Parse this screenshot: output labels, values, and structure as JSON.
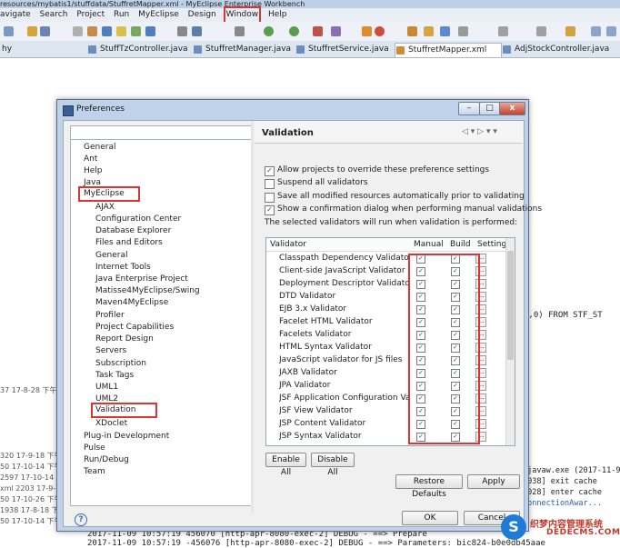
{
  "window": {
    "title": "resources/mybatis1/stuffdata/StuffretMapper.xml - MyEclipse Enterprise Workbench",
    "menu": [
      "avigate",
      "Search",
      "Project",
      "Run",
      "MyEclipse",
      "Design",
      "Window",
      "Help"
    ],
    "left_tab_fragment": "hy"
  },
  "file_tabs": [
    "StuffTzController.java",
    "StuffretManager.java",
    "StuffretService.java",
    "StuffretMapper.xml",
    "AdjStockController.java"
  ],
  "background": {
    "left_fragments": [
      "37  17-8-28 下午",
      "320  17-9-18 下午",
      "50  17-10-14 下午",
      "2597  17-10-14 下午",
      "xml  2203  17-9-18 下午",
      "50  17-10-26 下午",
      "1938  17-8-18 下午",
      "50  17-10-14 下午"
    ],
    "sql_fragment": "),0) FROM STF_ST",
    "right_fragments": [
      "\\javaw.exe (2017-11-9 ",
      "1038] exit cache",
      "1028] enter cache",
      "ConnectionAwar..."
    ],
    "log_lines": [
      "2017-11-09 10:57:19  456070 [http-apr-8080-exec-2] DEBUG  - ==> Prepare",
      "2017-11-09 10:57:19 -456076 [http-apr-8080-exec-2] DEBUG  - ==> Parameters: bic824-b0e0db45aae"
    ]
  },
  "watermark": {
    "text": "织梦内容管理系统",
    "url": "DEDECMS.COM"
  },
  "dialog": {
    "title": "Preferences",
    "filter_placeholder": "",
    "tree": [
      "General",
      "Ant",
      "Help",
      "Java",
      "MyEclipse",
      "AJAX",
      "Configuration Center",
      "Database Explorer",
      "Files and Editors",
      "General",
      "Internet Tools",
      "Java Enterprise Project",
      "Matisse4MyEclipse/Swing",
      "Maven4MyEclipse",
      "Profiler",
      "Project Capabilities",
      "Report Design",
      "Servers",
      "Subscription",
      "Task Tags",
      "UML1",
      "UML2",
      "Validation",
      "XDoclet",
      "Plug-in Development",
      "Pulse",
      "Run/Debug",
      "Team"
    ],
    "page_title": "Validation",
    "options": [
      {
        "label": "Allow projects to override these preference settings",
        "checked": true
      },
      {
        "label": "Suspend all validators",
        "checked": false
      },
      {
        "label": "Save all modified resources automatically prior to validating",
        "checked": false
      },
      {
        "label": "Show a confirmation dialog when performing manual validations",
        "checked": true
      }
    ],
    "validators_caption": "The selected validators will run when validation is performed:",
    "table_headers": [
      "Validator",
      "Manual",
      "Build",
      "Setting"
    ],
    "validators": [
      "Classpath Dependency Validator",
      "Client-side JavaScript Validator",
      "Deployment Descriptor Validator",
      "DTD Validator",
      "EJB 3.x Validator",
      "Facelet HTML Validator",
      "Facelets Validator",
      "HTML Syntax Validator",
      "JavaScript validator for JS files",
      "JAXB Validator",
      "JPA Validator",
      "JSF Application Configuration Valida...",
      "JSF View Validator",
      "JSP Content Validator",
      "JSP Syntax Validator"
    ],
    "buttons": {
      "enable_all": "Enable All",
      "disable_all": "Disable All",
      "restore": "Restore Defaults",
      "apply": "Apply",
      "ok": "OK",
      "cancel": "Cancel"
    },
    "help_glyph": "?",
    "minimize": "–",
    "maximize": "□",
    "close": "x"
  }
}
